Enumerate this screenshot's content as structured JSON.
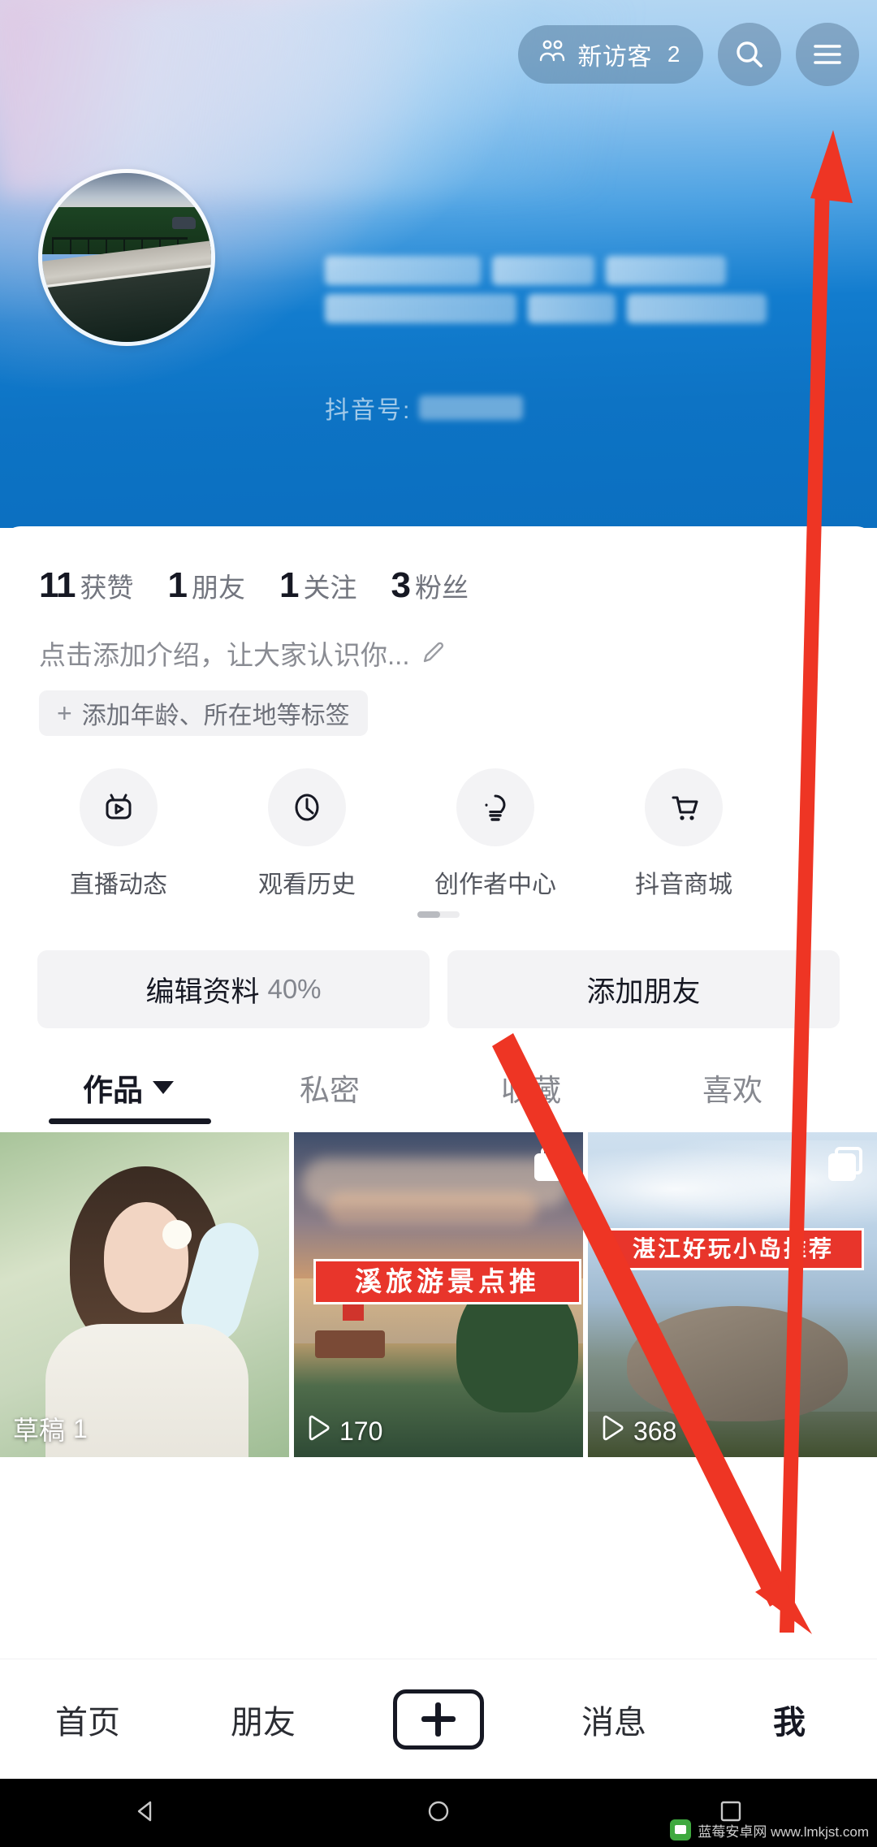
{
  "header": {
    "visitors_label": "新访客",
    "visitors_count": "2",
    "visitors_icon": "visitors-icon",
    "search_icon": "search-icon",
    "menu_icon": "hamburger-menu-icon",
    "douyin_id_label": "抖音号:",
    "douyin_id_value": ""
  },
  "stats": [
    {
      "num": "11",
      "label": "获赞"
    },
    {
      "num": "1",
      "label": "朋友"
    },
    {
      "num": "1",
      "label": "关注"
    },
    {
      "num": "3",
      "label": "粉丝"
    }
  ],
  "bio": {
    "placeholder": "点击添加介绍，让大家认识你...",
    "edit_icon": "pencil-icon",
    "tag_plus": "+",
    "tag_label": "添加年龄、所在地等标签"
  },
  "shortcuts": [
    {
      "label": "直播动态",
      "icon": "live-tv-icon"
    },
    {
      "label": "观看历史",
      "icon": "clock-icon"
    },
    {
      "label": "创作者中心",
      "icon": "lightbulb-icon"
    },
    {
      "label": "抖音商城",
      "icon": "shopping-cart-icon"
    }
  ],
  "actions": {
    "edit_profile_label": "编辑资料",
    "edit_profile_percent": "40%",
    "add_friend_label": "添加朋友"
  },
  "tabs": [
    {
      "label": "作品",
      "active": true,
      "has_caret": true
    },
    {
      "label": "私密",
      "active": false,
      "has_caret": false
    },
    {
      "label": "收藏",
      "active": false,
      "has_caret": false
    },
    {
      "label": "喜欢",
      "active": false,
      "has_caret": false
    }
  ],
  "grid": [
    {
      "meta_type": "draft",
      "meta_label": "草稿",
      "meta_value": "1",
      "multi": false,
      "banner": ""
    },
    {
      "meta_type": "play",
      "meta_label": "",
      "meta_value": "170",
      "multi": true,
      "banner": "溪旅游景点推"
    },
    {
      "meta_type": "play",
      "meta_label": "",
      "meta_value": "368",
      "multi": true,
      "banner": "湛江好玩小岛推荐"
    }
  ],
  "bottom_nav": [
    {
      "label": "首页",
      "active": false
    },
    {
      "label": "朋友",
      "active": false
    },
    {
      "label": "+",
      "active": false
    },
    {
      "label": "消息",
      "active": false
    },
    {
      "label": "我",
      "active": true
    }
  ],
  "system_bar": {
    "back_icon": "triangle-back-icon",
    "home_icon": "circle-home-icon",
    "recents_icon": "square-recents-icon"
  },
  "watermark": {
    "text": "蓝莓安卓网 www.lmkjst.com"
  },
  "colors": {
    "accent_blue": "#0b6fc0",
    "annotation_red": "#ee3524",
    "text_primary": "#161823",
    "text_secondary": "#72757e",
    "chip_bg": "#f3f3f5"
  }
}
